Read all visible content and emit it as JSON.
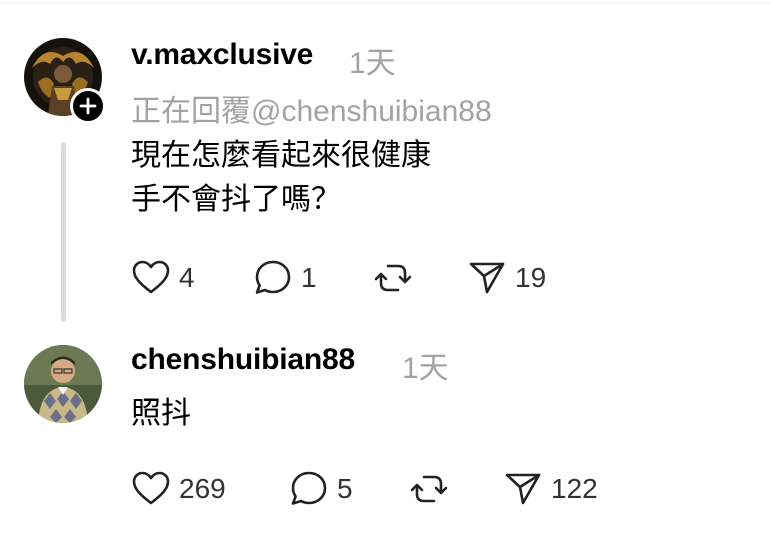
{
  "posts": [
    {
      "username": "v.maxclusive",
      "time": "1天",
      "reply_to": "正在回覆@chenshuibian88",
      "lines": [
        "現在怎麼看起來很健康",
        "手不會抖了嗎？"
      ],
      "likes": "4",
      "comments": "1",
      "shares": "19"
    },
    {
      "username": "chenshuibian88",
      "time": "1天",
      "lines": [
        "照抖"
      ],
      "likes": "269",
      "comments": "5",
      "shares": "122"
    }
  ],
  "icons": [
    "heart-icon",
    "comment-icon",
    "repost-icon",
    "send-icon",
    "plus-icon"
  ],
  "colors": {
    "muted_text": "#a3a3a3",
    "thread_line": "#dcdcdc"
  }
}
